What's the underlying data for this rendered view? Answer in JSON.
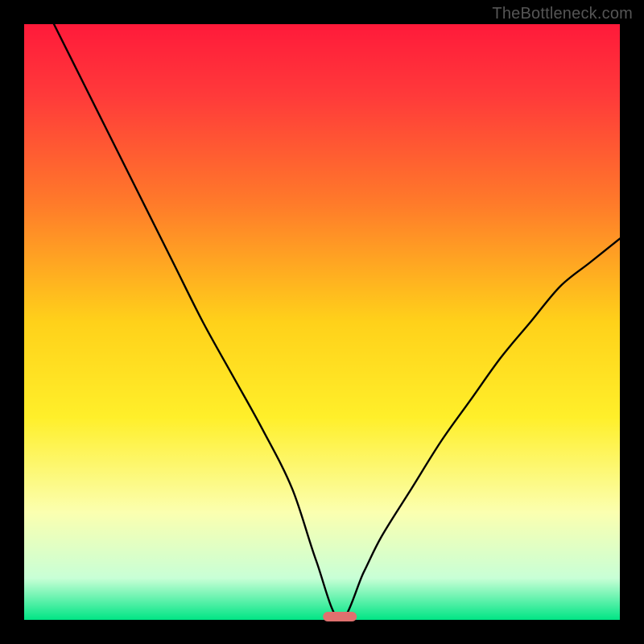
{
  "watermark": "TheBottleneck.com",
  "chart_data": {
    "type": "line",
    "title": "",
    "xlabel": "",
    "ylabel": "",
    "xlim": [
      0,
      100
    ],
    "ylim": [
      0,
      100
    ],
    "grid": false,
    "legend": false,
    "optimal_marker": {
      "x": 53,
      "color": "#e0706e"
    },
    "gradient_stops": [
      {
        "offset": 0.0,
        "color": "#ff1a3a"
      },
      {
        "offset": 0.12,
        "color": "#ff3a3a"
      },
      {
        "offset": 0.3,
        "color": "#ff7a2a"
      },
      {
        "offset": 0.5,
        "color": "#ffd11a"
      },
      {
        "offset": 0.66,
        "color": "#ffef2a"
      },
      {
        "offset": 0.82,
        "color": "#fbffb0"
      },
      {
        "offset": 0.93,
        "color": "#c8ffd6"
      },
      {
        "offset": 1.0,
        "color": "#00e585"
      }
    ],
    "series": [
      {
        "name": "bottleneck-curve",
        "x": [
          5,
          10,
          15,
          20,
          25,
          30,
          35,
          40,
          45,
          49,
          53,
          57,
          60,
          65,
          70,
          75,
          80,
          85,
          90,
          95,
          100
        ],
        "values": [
          100,
          90,
          80,
          70,
          60,
          50,
          41,
          32,
          22,
          10,
          0,
          8,
          14,
          22,
          30,
          37,
          44,
          50,
          56,
          60,
          64
        ]
      }
    ]
  },
  "plot_geometry": {
    "inner_left": 30,
    "inner_top": 30,
    "inner_width": 740,
    "inner_height": 740
  }
}
